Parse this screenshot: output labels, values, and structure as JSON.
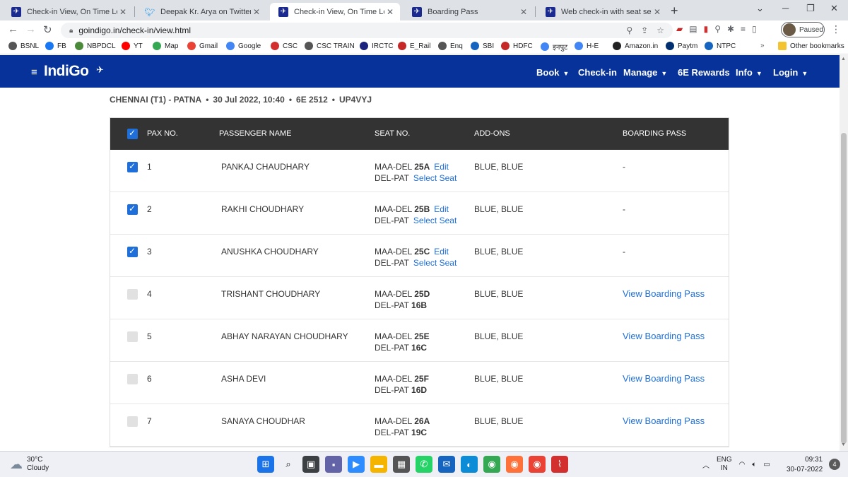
{
  "browser": {
    "tabs": [
      {
        "title": "Check-in View, On Time Low Cos",
        "icon": "indigo-favicon",
        "active": false
      },
      {
        "title": "Deepak Kr. Arya on Twitter: \"@In",
        "icon": "twitter-favicon",
        "active": false
      },
      {
        "title": "Check-in View, On Time Low Cos",
        "icon": "indigo-favicon",
        "active": true
      },
      {
        "title": "Boarding Pass",
        "icon": "indigo-favicon",
        "active": false
      },
      {
        "title": "Web check-in with seat selection",
        "icon": "indigo-favicon",
        "active": false
      }
    ],
    "url": "goindigo.in/check-in/view.html",
    "profile_status": "Paused",
    "bookmarks": [
      {
        "label": "BSNL",
        "color": "#555555"
      },
      {
        "label": "FB",
        "color": "#1877f2"
      },
      {
        "label": "NBPDCL",
        "color": "#4a8a3a"
      },
      {
        "label": "YT",
        "color": "#ff0000"
      },
      {
        "label": "Map",
        "color": "#34a853"
      },
      {
        "label": "Gmail",
        "color": "#ea4335"
      },
      {
        "label": "Google",
        "color": "#4285f4"
      },
      {
        "label": "CSC",
        "color": "#d32f2f"
      },
      {
        "label": "CSC TRAIN",
        "color": "#555555"
      },
      {
        "label": "IRCTC",
        "color": "#1a237e"
      },
      {
        "label": "E_Rail",
        "color": "#c62828"
      },
      {
        "label": "Enq",
        "color": "#555555"
      },
      {
        "label": "SBI",
        "color": "#1565c0"
      },
      {
        "label": "HDFC",
        "color": "#c62828"
      },
      {
        "label": "इनपुट",
        "color": "#4285f4"
      },
      {
        "label": "H-E",
        "color": "#4285f4"
      },
      {
        "label": "Amazon.in",
        "color": "#222222"
      },
      {
        "label": "Paytm",
        "color": "#002e6e"
      },
      {
        "label": "NTPC",
        "color": "#1565c0"
      }
    ],
    "bookmarks_overflow": "»",
    "other_bookmarks": "Other bookmarks"
  },
  "header": {
    "logo": "IndiGo",
    "nav": [
      {
        "label": "Book",
        "chevron": true
      },
      {
        "label": "Check-in",
        "chevron": false
      },
      {
        "label": "Manage",
        "chevron": true
      },
      {
        "label": "6E Rewards",
        "chevron": false
      },
      {
        "label": "Info",
        "chevron": true
      },
      {
        "label": "Login",
        "chevron": true
      }
    ],
    "brand_color": "#073299"
  },
  "flight": {
    "route": "CHENNAI (T1) - PATNA",
    "datetime": "30 Jul 2022, 10:40",
    "flight_no": "6E 2512",
    "pnr": "UP4VYJ"
  },
  "table": {
    "headers": {
      "pax": "PAX NO.",
      "name": "PASSENGER NAME",
      "seat": "SEAT NO.",
      "addons": "ADD-ONS",
      "boarding": "BOARDING PASS"
    },
    "all_selected": true,
    "rows": [
      {
        "pax": "1",
        "name": "PANKAJ CHAUDHARY",
        "checked": true,
        "seg1": "MAA-DEL",
        "seat1": "25A",
        "seat1_action": "Edit",
        "seg2": "DEL-PAT",
        "seat2": "",
        "seat2_action": "Select Seat",
        "addons": "BLUE, BLUE",
        "boarding": "-",
        "boarding_link": false
      },
      {
        "pax": "2",
        "name": "RAKHI CHOUDHARY",
        "checked": true,
        "seg1": "MAA-DEL",
        "seat1": "25B",
        "seat1_action": "Edit",
        "seg2": "DEL-PAT",
        "seat2": "",
        "seat2_action": "Select Seat",
        "addons": "BLUE, BLUE",
        "boarding": "-",
        "boarding_link": false
      },
      {
        "pax": "3",
        "name": "ANUSHKA CHOUDHARY",
        "checked": true,
        "seg1": "MAA-DEL",
        "seat1": "25C",
        "seat1_action": "Edit",
        "seg2": "DEL-PAT",
        "seat2": "",
        "seat2_action": "Select Seat",
        "addons": "BLUE, BLUE",
        "boarding": "-",
        "boarding_link": false
      },
      {
        "pax": "4",
        "name": "TRISHANT CHOUDHARY",
        "checked": false,
        "seg1": "MAA-DEL",
        "seat1": "25D",
        "seat1_action": "",
        "seg2": "DEL-PAT",
        "seat2": "16B",
        "seat2_action": "",
        "addons": "BLUE, BLUE",
        "boarding": "View Boarding Pass",
        "boarding_link": true
      },
      {
        "pax": "5",
        "name": "ABHAY NARAYAN CHOUDHARY",
        "checked": false,
        "seg1": "MAA-DEL",
        "seat1": "25E",
        "seat1_action": "",
        "seg2": "DEL-PAT",
        "seat2": "16C",
        "seat2_action": "",
        "addons": "BLUE, BLUE",
        "boarding": "View Boarding Pass",
        "boarding_link": true
      },
      {
        "pax": "6",
        "name": "ASHA DEVI",
        "checked": false,
        "seg1": "MAA-DEL",
        "seat1": "25F",
        "seat1_action": "",
        "seg2": "DEL-PAT",
        "seat2": "16D",
        "seat2_action": "",
        "addons": "BLUE, BLUE",
        "boarding": "View Boarding Pass",
        "boarding_link": true
      },
      {
        "pax": "7",
        "name": "SANAYA CHOUDHAR",
        "checked": false,
        "seg1": "MAA-DEL",
        "seat1": "26A",
        "seat1_action": "",
        "seg2": "DEL-PAT",
        "seat2": "19C",
        "seat2_action": "",
        "addons": "BLUE, BLUE",
        "boarding": "View Boarding Pass",
        "boarding_link": true
      }
    ]
  },
  "taskbar": {
    "temperature": "30°C",
    "weather": "Cloudy",
    "language": "ENG",
    "region": "IN",
    "time": "09:31",
    "date": "30-07-2022",
    "notifications": "4",
    "apps": [
      {
        "name": "start-icon",
        "color": "#1a73e8",
        "glyph": "⊞"
      },
      {
        "name": "search-icon",
        "color": "#eef0f5",
        "glyph": "⌕"
      },
      {
        "name": "task-view-icon",
        "color": "#3c4043",
        "glyph": "▣"
      },
      {
        "name": "teams-chat-icon",
        "color": "#6264a7",
        "glyph": "▪"
      },
      {
        "name": "zoom-icon",
        "color": "#2d8cff",
        "glyph": "▶"
      },
      {
        "name": "file-explorer-icon",
        "color": "#f4b400",
        "glyph": "▬"
      },
      {
        "name": "calculator-icon",
        "color": "#555555",
        "glyph": "▦"
      },
      {
        "name": "whatsapp-icon",
        "color": "#25d366",
        "glyph": "✆"
      },
      {
        "name": "app-icon",
        "color": "#1565c0",
        "glyph": "✉"
      },
      {
        "name": "edge-icon",
        "color": "#0c8bd6",
        "glyph": "◐"
      },
      {
        "name": "chrome-icon",
        "color": "#34a853",
        "glyph": "◉"
      },
      {
        "name": "firefox-icon",
        "color": "#ff7139",
        "glyph": "◉"
      },
      {
        "name": "chrome-active-icon",
        "color": "#ea4335",
        "glyph": "◉"
      },
      {
        "name": "acrobat-icon",
        "color": "#d32f2f",
        "glyph": "⌇"
      }
    ]
  }
}
